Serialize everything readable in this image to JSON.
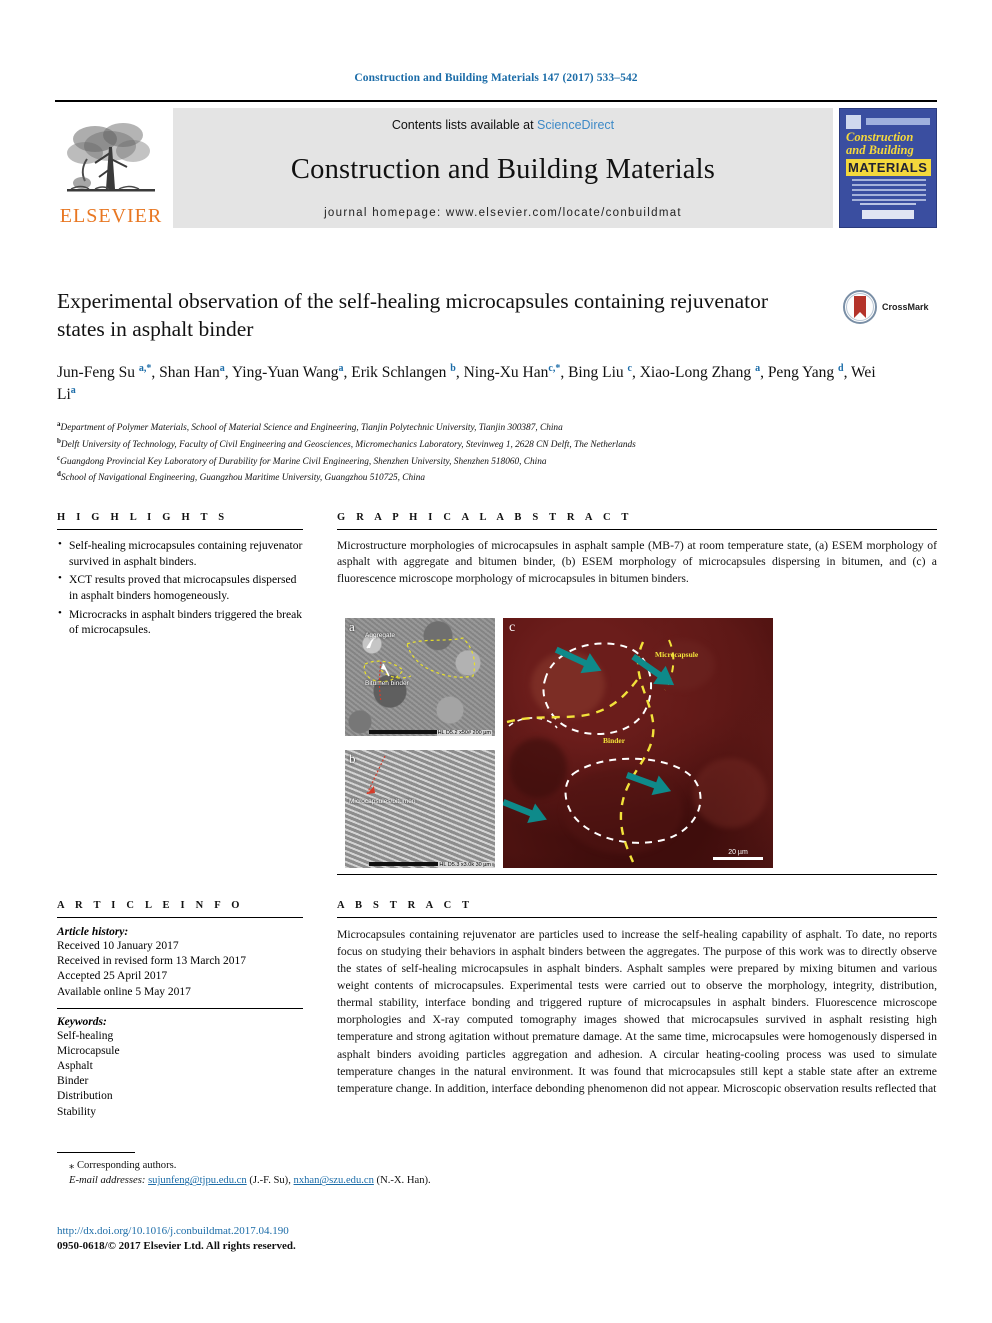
{
  "running_head": "Construction and Building Materials 147 (2017) 533–542",
  "masthead": {
    "contents_prefix": "Contents lists available at ",
    "sciencedirect": "ScienceDirect",
    "journal_title": "Construction and Building Materials",
    "homepage": "journal homepage: www.elsevier.com/locate/conbuildmat",
    "publisher": "ELSEVIER",
    "cover": {
      "line1": "Construction",
      "line2": "and Building",
      "line3": "MATERIALS"
    }
  },
  "article": {
    "title": "Experimental observation of the self-healing microcapsules containing rejuvenator states in asphalt binder",
    "crossmark_label": "CrossMark",
    "authors_html": "Jun-Feng Su <sup>a,*</sup>, Shan Han<sup>a</sup>, Ying-Yuan Wang<sup>a</sup>, Erik Schlangen <sup>b</sup>, Ning-Xu Han<sup>c,*</sup>, Bing Liu <sup>c</sup>, Xiao-Long Zhang <sup>a</sup>, Peng Yang <sup>d</sup>, Wei Li<sup>a</sup>",
    "affiliations": [
      {
        "marker": "a",
        "text": "Department of Polymer Materials, School of Material Science and Engineering, Tianjin Polytechnic University, Tianjin 300387, China"
      },
      {
        "marker": "b",
        "text": "Delft University of Technology, Faculty of Civil Engineering and Geosciences, Micromechanics Laboratory, Stevinweg 1, 2628 CN Delft, The Netherlands"
      },
      {
        "marker": "c",
        "text": "Guangdong Provincial Key Laboratory of Durability for Marine Civil Engineering, Shenzhen University, Shenzhen 518060, China"
      },
      {
        "marker": "d",
        "text": "School of Navigational Engineering, Guangzhou Maritime University, Guangzhou 510725, China"
      }
    ]
  },
  "highlights": {
    "heading": "H I G H L I G H T S",
    "items": [
      "Self-healing microcapsules containing rejuvenator survived in asphalt binders.",
      "XCT results proved that microcapsules dispersed in asphalt binders homogeneously.",
      "Microcracks in asphalt binders triggered the break of microcapsules."
    ]
  },
  "graphical_abstract": {
    "heading": "G R A P H I C A L   A B S T R A C T",
    "caption": "Microstructure morphologies of microcapsules in asphalt sample (MB-7) at room temperature state, (a) ESEM morphology of asphalt with aggregate and bitumen binder, (b) ESEM morphology of microcapsules dispersing in bitumen, and (c) a fluorescence microscope morphology of microcapsules in bitumen binders.",
    "figure": {
      "panel_a_label": "a",
      "panel_b_label": "b",
      "panel_c_label": "c",
      "anno_aggregate": "Aggregate",
      "anno_bitumen_binder": "Bitumen binder",
      "anno_microcapsules_bitumen": "Microcapsules/bitumen",
      "anno_microcapsule": "Microcapsule",
      "anno_binder": "Binder",
      "scale_a": "HL  D5.2  x50#    200 µm",
      "scale_b": "HL  D5.3  x3.0k    30 µm",
      "scale_c": "20 µm"
    }
  },
  "article_info": {
    "heading": "A R T I C L E   I N F O",
    "history_title": "Article history:",
    "history": [
      "Received 10 January 2017",
      "Received in revised form 13 March 2017",
      "Accepted 25 April 2017",
      "Available online 5 May 2017"
    ],
    "keywords_title": "Keywords:",
    "keywords": [
      "Self-healing",
      "Microcapsule",
      "Asphalt",
      "Binder",
      "Distribution",
      "Stability"
    ]
  },
  "abstract": {
    "heading": "A B S T R A C T",
    "text": "Microcapsules containing rejuvenator are particles used to increase the self-healing capability of asphalt. To date, no reports focus on studying their behaviors in asphalt binders between the aggregates. The purpose of this work was to directly observe the states of self-healing microcapsules in asphalt binders. Asphalt samples were prepared by mixing bitumen and various weight contents of microcapsules. Experimental tests were carried out to observe the morphology, integrity, distribution, thermal stability, interface bonding and triggered rupture of microcapsules in asphalt binders. Fluorescence microscope morphologies and X-ray computed tomography images showed that microcapsules survived in asphalt resisting high temperature and strong agitation without premature damage. At the same time, microcapsules were homogenously dispersed in asphalt binders avoiding particles aggregation and adhesion. A circular heating-cooling process was used to simulate temperature changes in the natural environment. It was found that microcapsules still kept a stable state after an extreme temperature change. In addition, interface debonding phenomenon did not appear. Microscopic observation results reflected that"
  },
  "footer": {
    "corresponding": "Corresponding authors.",
    "email_label": "E-mail addresses:",
    "email1": "sujunfeng@tjpu.edu.cn",
    "email1_owner": "(J.-F. Su),",
    "email2": "nxhan@szu.edu.cn",
    "email2_owner": "(N.-X. Han).",
    "doi": "http://dx.doi.org/10.1016/j.conbuildmat.2017.04.190",
    "copyright": "0950-0618/© 2017 Elsevier Ltd. All rights reserved."
  },
  "colors": {
    "link_blue": "#1b6ca8",
    "elsevier_orange": "#E87722",
    "cover_blue": "#3a4ea0",
    "cover_yellow": "#f4d83c",
    "teal_arrow": "#0e8a8a"
  }
}
